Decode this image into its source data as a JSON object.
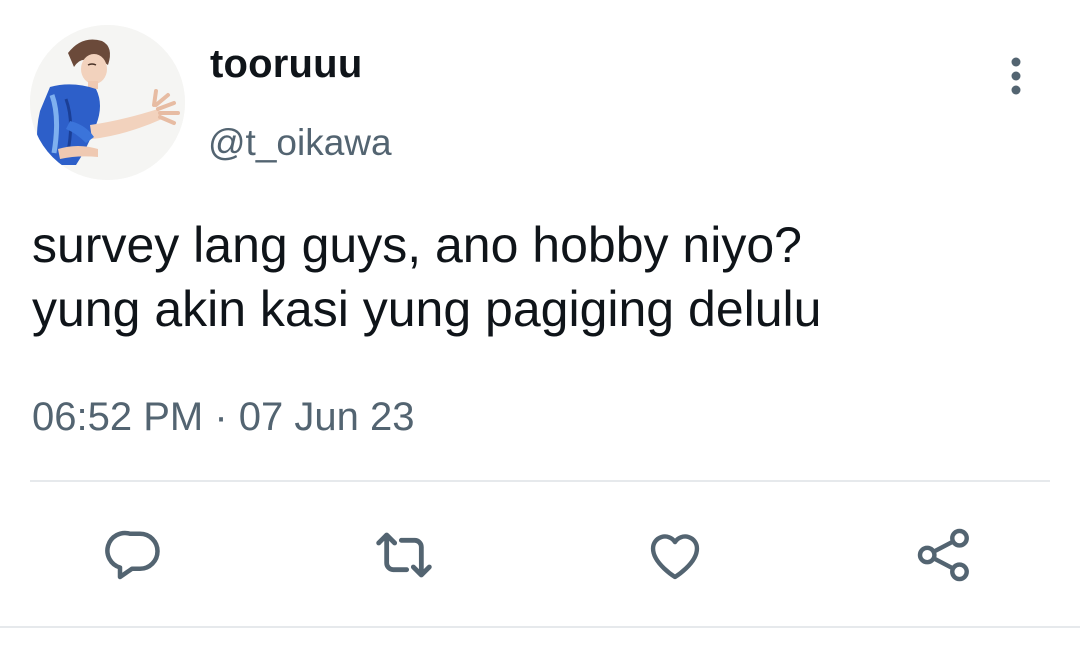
{
  "author": {
    "display_name": "tooruuu",
    "handle": "@t_oikawa",
    "avatar_icon": "avatar-volleyball-player"
  },
  "tweet": {
    "lines": [
      "survey lang guys, ano hobby niyo?",
      "yung akin kasi yung pagiging delulu"
    ],
    "time": "06:52 PM",
    "separator": "·",
    "date": "07 Jun 23"
  },
  "actions": [
    {
      "name": "reply",
      "icon": "reply-icon"
    },
    {
      "name": "retweet",
      "icon": "retweet-icon"
    },
    {
      "name": "like",
      "icon": "heart-icon"
    },
    {
      "name": "share",
      "icon": "share-icon"
    }
  ],
  "colors": {
    "text": "#0f1419",
    "secondary": "#536471",
    "divider": "#e6e9ec"
  }
}
